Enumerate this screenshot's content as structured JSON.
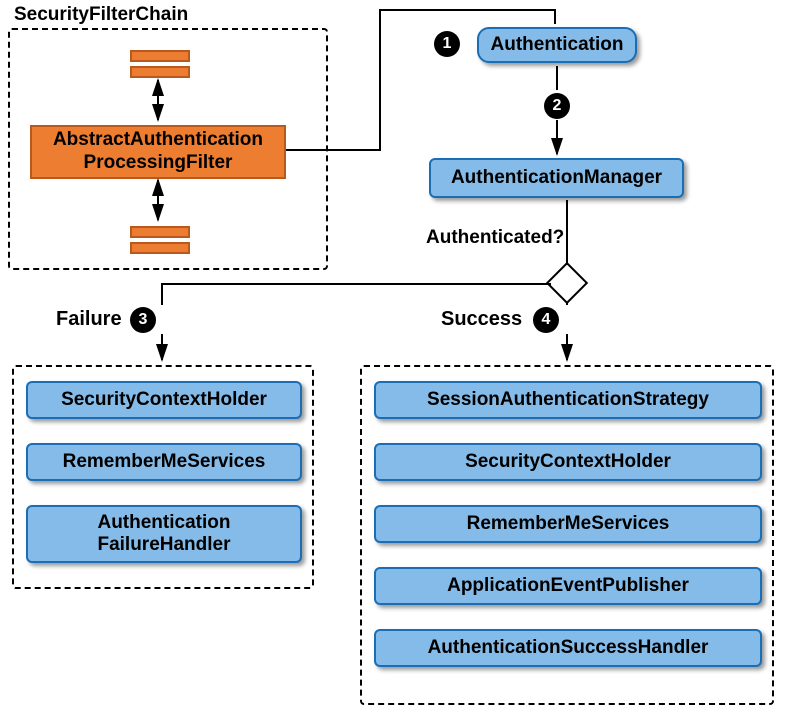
{
  "filterChain": {
    "title": "SecurityFilterChain",
    "mainFilter": "AbstractAuthentication\nProcessingFilter"
  },
  "authentication": {
    "label": "Authentication",
    "manager": "AuthenticationManager",
    "question": "Authenticated?"
  },
  "badges": {
    "b1": "1",
    "b2": "2",
    "b3": "3",
    "b4": "4"
  },
  "branches": {
    "failure": "Failure",
    "success": "Success"
  },
  "failureBoxes": {
    "0": "SecurityContextHolder",
    "1": "RememberMeServices",
    "2": "Authentication\nFailureHandler"
  },
  "successBoxes": {
    "0": "SessionAuthenticationStrategy",
    "1": "SecurityContextHolder",
    "2": "RememberMeServices",
    "3": "ApplicationEventPublisher",
    "4": "AuthenticationSuccessHandler"
  }
}
